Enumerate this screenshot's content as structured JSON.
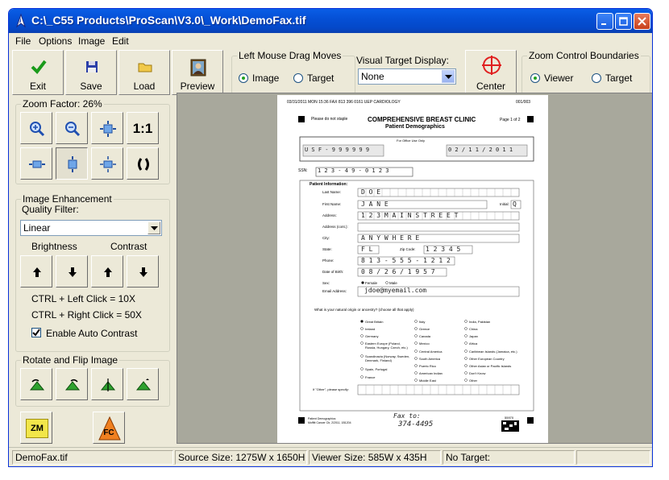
{
  "window": {
    "title": "C:\\_C55 Products\\ProScan\\V3.0\\_Work\\DemoFax.tif"
  },
  "menu": [
    "File",
    "Options",
    "Image",
    "Edit"
  ],
  "toolbar": {
    "exit_label": "Exit",
    "save_label": "Save",
    "load_label": "Load",
    "preview_label": "Preview",
    "drag_group_title": "Left Mouse Drag Moves",
    "drag_image_label": "Image",
    "drag_target_label": "Target",
    "drag_selected": "Image",
    "visual_target_title": "Visual Target Display:",
    "visual_target_value": "None",
    "center_label": "Center",
    "zoom_bounds_title": "Zoom Control Boundaries",
    "zoom_viewer_label": "Viewer",
    "zoom_target_label": "Target",
    "zoom_selected": "Viewer"
  },
  "left_panel": {
    "zoom_title": "Zoom Factor: 26%",
    "zoom_one_to_one": "1:1",
    "enhance_title": "Image Enhancement",
    "quality_label": "Quality Filter:",
    "quality_value": "Linear",
    "brightness_label": "Brightness",
    "contrast_label": "Contrast",
    "ctrl_left": "CTRL + Left Click = 10X",
    "ctrl_right": "CTRL + Right Click = 50X",
    "auto_contrast_label": "Enable Auto Contrast",
    "auto_contrast_checked": true,
    "rotate_title": "Rotate and Flip Image",
    "zm_label": "ZM",
    "fc_label": "FC"
  },
  "document": {
    "header_line": "03/31/2011 MON 15:36  FAX 813 396 0161 UEP  CARDIOLOGY",
    "header_page": "001/003",
    "please_staple": "Please do not staple",
    "clinic": "COMPREHENSIVE BREAST CLINIC",
    "subtitle": "Patient Demographics",
    "page_of": "Page 1 of 2",
    "office_use": "For Office Use Only",
    "id_value": "U S F - 9 9 9 9 9 9",
    "date_value": "0 2 / 1 1 / 2 0 1 1",
    "ssn_label": "SSN:",
    "ssn_value": "1 2 3 - 4 9 - 0 1 2 3",
    "patient_info": "Patient Information:",
    "fields": [
      {
        "label": "Last Name:",
        "value": "D O E"
      },
      {
        "label": "First Name:",
        "value": "J A N E"
      },
      {
        "label": "Address:",
        "value": "1 2 3   M A I N   S T R E E T"
      },
      {
        "label": "Address (cont.):",
        "value": ""
      },
      {
        "label": "City:",
        "value": "A N Y W H E R E"
      },
      {
        "label": "State:",
        "value": "F L"
      },
      {
        "label": "Phone:",
        "value": "8 1 3 - 5 5 5 - 1 2 1 2"
      },
      {
        "label": "Date of Birth:",
        "value": "0 8 / 2 6 / 1 9 5 7"
      },
      {
        "label": "Sex:",
        "value": ""
      },
      {
        "label": "Email Address:",
        "value": "jdoe@myemail.com"
      }
    ],
    "initial_label": "Initial:",
    "initial_value": "Q",
    "zip_label": "Zip Code:",
    "zip_value": "1 2 3 4 5",
    "sex_female": "Female",
    "sex_male": "Male",
    "origin_question": "What is your natural origin or ancestry? (choose all that apply)",
    "origins_col1": [
      "Great Britain",
      "Ireland",
      "Germany",
      "Eastern Europe (Poland, Russia, Hungary, Czech, etc.)",
      "Scandinavia (Norway, Sweden, Denmark, Finland)",
      "Spain, Portugal",
      "France"
    ],
    "origins_col2": [
      "Italy",
      "Greece",
      "Canada",
      "Mexico",
      "Central America",
      "South America",
      "Puerto Rico",
      "American Indian",
      "Middle East"
    ],
    "origins_col3": [
      "India, Pakistan",
      "China",
      "Japan",
      "Africa",
      "Caribbean Islands (Jamaica, etc.)",
      "Other European Country",
      "Other Asian or Pacific Islands",
      "Don't Know",
      "Other"
    ],
    "other_label": "If \"Other\", please specify:",
    "footer_left1": "Patient Demographics",
    "footer_left2": "Moffitt Cancer Ctr, 2/2011, 1B1204",
    "fax_note": "Fax to:",
    "fax_number": "374-4495",
    "footer_code": "55970"
  },
  "status": {
    "file": "DemoFax.tif",
    "source_size": "Source Size: 1275W x 1650H",
    "viewer_size": "Viewer Size: 585W x 435H",
    "target": "No Target:"
  }
}
